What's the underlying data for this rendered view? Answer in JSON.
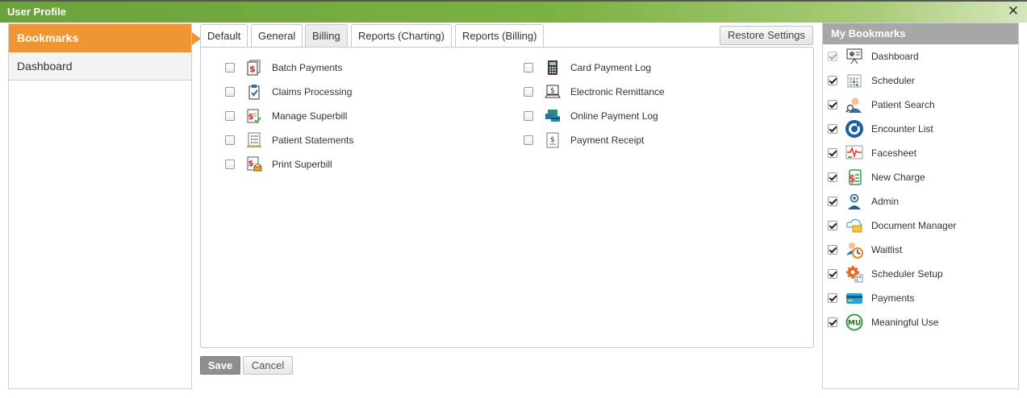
{
  "window": {
    "title": "User Profile",
    "close_glyph": "✕"
  },
  "leftnav": {
    "items": [
      {
        "label": "Bookmarks",
        "active": true
      },
      {
        "label": "Dashboard",
        "active": false
      }
    ]
  },
  "tabs": [
    {
      "label": "Default",
      "active": false
    },
    {
      "label": "General",
      "active": false
    },
    {
      "label": "Billing",
      "active": true
    },
    {
      "label": "Reports (Charting)",
      "active": false
    },
    {
      "label": "Reports (Billing)",
      "active": false
    }
  ],
  "restore_label": "Restore Settings",
  "billing": {
    "items": [
      {
        "label": "Batch Payments",
        "icon": "batch-payments-icon",
        "checked": false
      },
      {
        "label": "Claims Processing",
        "icon": "clipboard-check-icon",
        "checked": false
      },
      {
        "label": "Manage Superbill",
        "icon": "superbill-check-icon",
        "checked": false
      },
      {
        "label": "Patient Statements",
        "icon": "statement-list-icon",
        "checked": false
      },
      {
        "label": "Print Superbill",
        "icon": "print-superbill-icon",
        "checked": false
      },
      {
        "label": "Card Payment Log",
        "icon": "calculator-icon",
        "checked": false
      },
      {
        "label": "Electronic Remittance",
        "icon": "laptop-dollar-icon",
        "checked": false
      },
      {
        "label": "Online Payment Log",
        "icon": "online-cards-icon",
        "checked": false
      },
      {
        "label": "Payment Receipt",
        "icon": "receipt-icon",
        "checked": false
      }
    ]
  },
  "buttons": {
    "save": "Save",
    "cancel": "Cancel"
  },
  "bookmarks": {
    "header": "My Bookmarks",
    "items": [
      {
        "label": "Dashboard",
        "icon": "presentation-board-icon",
        "checked": true,
        "disabled": true
      },
      {
        "label": "Scheduler",
        "icon": "calendar-grid-icon",
        "checked": true,
        "disabled": false
      },
      {
        "label": "Patient Search",
        "icon": "person-search-icon",
        "checked": true,
        "disabled": false
      },
      {
        "label": "Encounter List",
        "icon": "refresh-circle-icon",
        "checked": true,
        "disabled": false
      },
      {
        "label": "Facesheet",
        "icon": "vitals-chart-icon",
        "checked": true,
        "disabled": false
      },
      {
        "label": "New Charge",
        "icon": "dollar-document-icon",
        "checked": true,
        "disabled": false
      },
      {
        "label": "Admin",
        "icon": "admin-person-icon",
        "checked": true,
        "disabled": false
      },
      {
        "label": "Document Manager",
        "icon": "cloud-folder-icon",
        "checked": true,
        "disabled": false
      },
      {
        "label": "Waitlist",
        "icon": "waitlist-clock-icon",
        "checked": true,
        "disabled": false
      },
      {
        "label": "Scheduler Setup",
        "icon": "gear-calendar-icon",
        "checked": true,
        "disabled": false
      },
      {
        "label": "Payments",
        "icon": "credit-card-icon",
        "checked": true,
        "disabled": false
      },
      {
        "label": "Meaningful Use",
        "icon": "mu-badge-icon",
        "checked": true,
        "disabled": false
      }
    ]
  },
  "colors": {
    "titlebar_green": "#7db244",
    "active_nav_orange": "#ef9533",
    "header_gray": "#a7a7a7",
    "save_gray": "#8e8e8e"
  }
}
